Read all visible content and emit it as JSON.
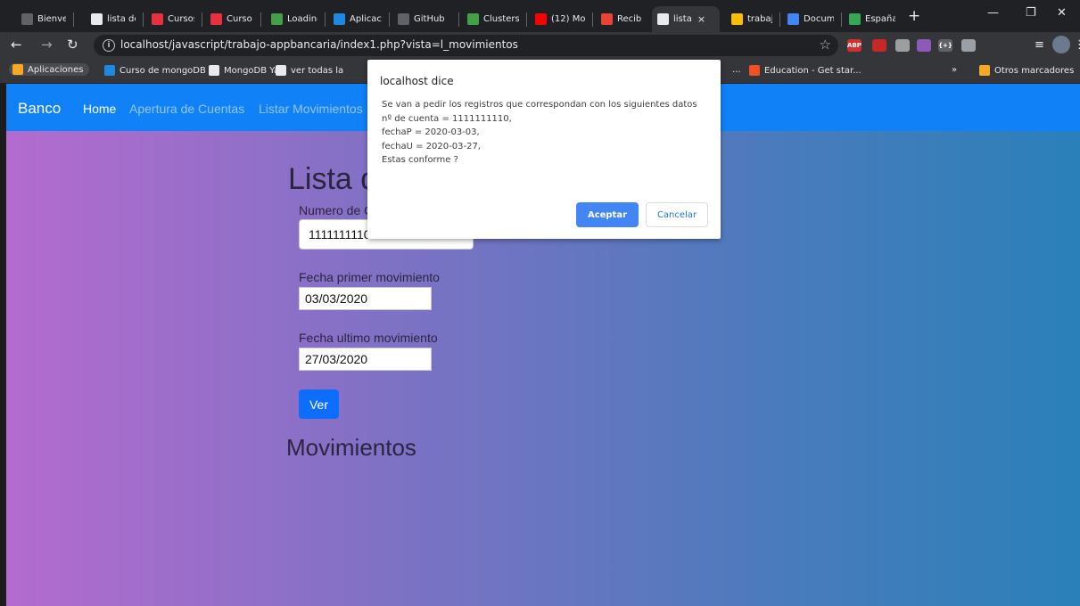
{
  "browser": {
    "tabs": [
      {
        "label": "Bienven",
        "icon": "spinner-icon",
        "color": "#5f6368"
      },
      {
        "label": "lista de",
        "icon": "globe-icon",
        "color": "#e8eaed"
      },
      {
        "label": "Cursos",
        "icon": "oracle-icon",
        "color": "#e8303f"
      },
      {
        "label": "Curso o",
        "icon": "oracle-icon",
        "color": "#e8303f"
      },
      {
        "label": "Loading",
        "icon": "leaf-icon",
        "color": "#43a047"
      },
      {
        "label": "Aplicaci",
        "icon": "app-icon",
        "color": "#1e88e5"
      },
      {
        "label": "GitHub",
        "icon": "spinner-icon",
        "color": "#5f6368"
      },
      {
        "label": "Clusters",
        "icon": "leaf-icon",
        "color": "#43a047"
      },
      {
        "label": "(12) Mo",
        "icon": "youtube-icon",
        "color": "#ff0000"
      },
      {
        "label": "Recibid",
        "icon": "gmail-icon",
        "color": "#ea4335"
      },
      {
        "label": "lista",
        "icon": "globe-icon",
        "color": "#e8eaed",
        "active": true
      },
      {
        "label": "trabajo",
        "icon": "drive-icon",
        "color": "#fbbc04"
      },
      {
        "label": "Docum",
        "icon": "docs-icon",
        "color": "#4285f4"
      },
      {
        "label": "España",
        "icon": "chart-icon",
        "color": "#34a853"
      }
    ],
    "new_tab_symbol": "+",
    "close_tab_symbol": "×",
    "url": "localhost/javascript/trabajo-appbancaria/index1.php?vista=l_movimientos",
    "extensions": [
      {
        "name": "adblock-plus-icon",
        "label": "ABP",
        "color": "#d32f2f"
      },
      {
        "name": "extension-red-icon",
        "label": "",
        "color": "#c62828"
      },
      {
        "name": "drive-extension-icon",
        "label": "",
        "color": "#9e9e9e"
      },
      {
        "name": "extension-flag-icon",
        "label": "",
        "color": "#8e5ab8"
      },
      {
        "name": "extension-code-icon",
        "label": "{+}",
        "color": "#5f6368"
      },
      {
        "name": "extension-puzzle-icon",
        "label": "",
        "color": "#9aa0a6"
      }
    ],
    "bookmarks": [
      {
        "label": "Aplicaciones",
        "icon": "apps-grid-icon",
        "color": "#f9a825",
        "chip": true
      },
      {
        "label": "Curso de mongoDB",
        "icon": "udemy-icon",
        "color": "#1e88e5"
      },
      {
        "label": "MongoDB Ya",
        "icon": "globe-icon",
        "color": "#e8eaed"
      },
      {
        "label": "ver todas la",
        "icon": "google-icon",
        "color": "#e8eaed"
      },
      {
        "label": "...",
        "icon": "",
        "color": ""
      },
      {
        "label": "Education - Get star...",
        "icon": "microsoft-icon",
        "color": "#f25022"
      },
      {
        "label": "»",
        "icon": "",
        "color": ""
      },
      {
        "label": "Otros marcadores",
        "icon": "folder-icon",
        "color": "#f9a825"
      }
    ]
  },
  "page": {
    "brand": "Banco",
    "nav": [
      "Home",
      "Apertura de Cuentas",
      "Listar Movimientos"
    ],
    "title": "Lista d",
    "cuenta_label": "Numero de C",
    "cuenta_value": "1111111110",
    "fecha_primer_label": "Fecha primer movimiento",
    "fecha_primer_value": "03/03/2020",
    "fecha_ultimo_label": "Fecha ultimo movimiento",
    "fecha_ultimo_value": "27/03/2020",
    "ver_button": "Ver",
    "movimientos_heading": "Movimientos"
  },
  "dialog": {
    "title": "localhost dice",
    "lines": [
      "Se van a pedir los registros que correspondan con los siguientes datos",
      "nº de cuenta = 1111111110,",
      "fechaP = 2020-03-03,",
      "fechaU = 2020-03-27,",
      "Estas conforme ?"
    ],
    "ok": "Aceptar",
    "cancel": "Cancelar"
  },
  "colors": {
    "navbar": "#1081f6",
    "primary_button": "#0d6efd",
    "dialog_ok": "#4285f4"
  }
}
